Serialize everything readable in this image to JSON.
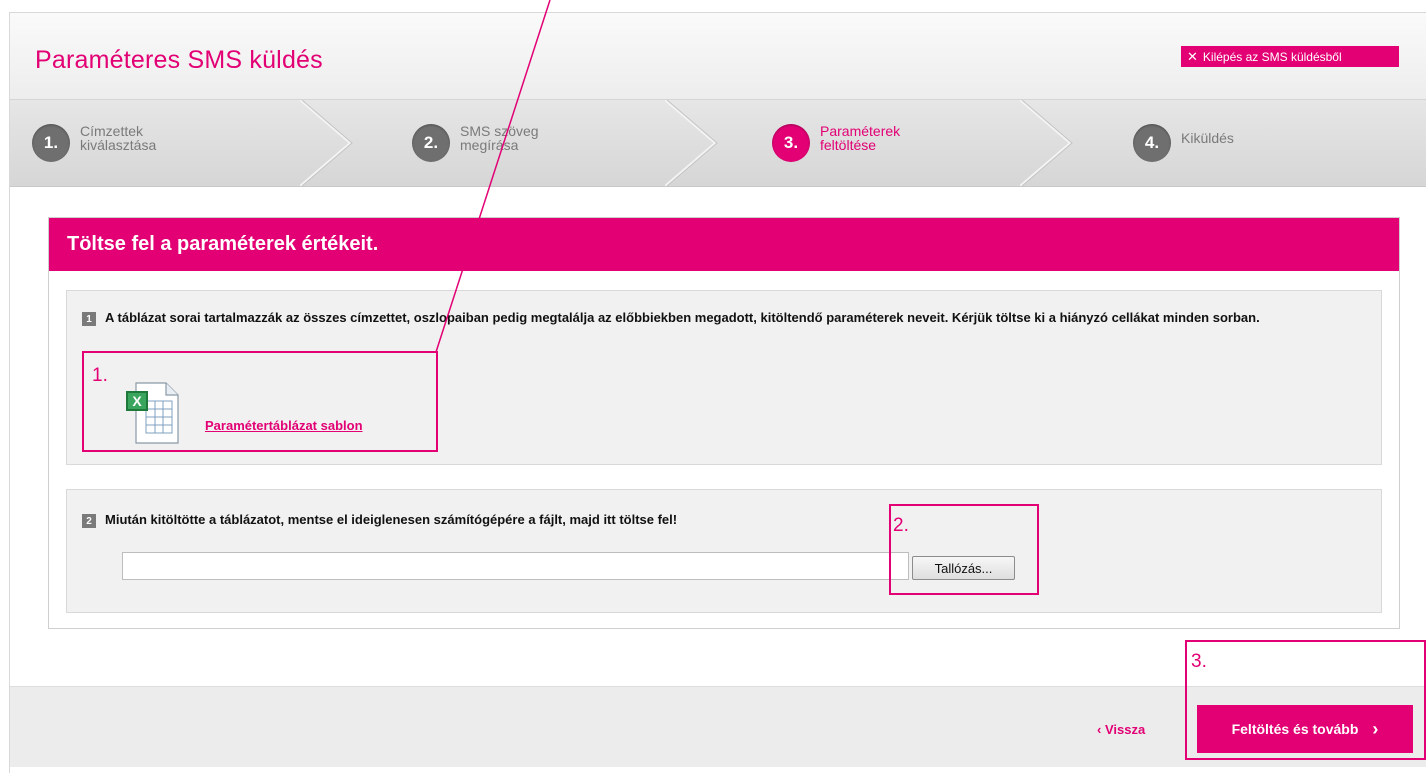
{
  "header": {
    "title": "Paraméteres SMS küldés",
    "exit_label": "Kilépés az SMS küldésből",
    "exit_icon": "close-icon"
  },
  "steps": [
    {
      "number": "1.",
      "label": "Címzettek\nkiválasztása",
      "active": false
    },
    {
      "number": "2.",
      "label": "SMS szöveg\nmegírása",
      "active": false
    },
    {
      "number": "3.",
      "label": "Paraméterek\nfeltöltése",
      "active": true
    },
    {
      "number": "4.",
      "label": "Kiküldés",
      "active": false
    }
  ],
  "panel": {
    "heading": "Töltse fel a paraméterek értékeit.",
    "section1": {
      "badge": "1",
      "text": "A táblázat sorai tartalmazzák az összes címzettet, oszlopaiban pedig megtalálja az előbbiekben megadott, kitöltendő paraméterek neveit. Kérjük töltse ki a hiányzó cellákat minden sorban.",
      "link_label": "Paramétertáblázat sablon",
      "icon": "excel-file-icon"
    },
    "section2": {
      "badge": "2",
      "text": "Miután kitöltötte a táblázatot, mentse el ideiglenesen számítógépére a fájlt, majd itt töltse fel!",
      "file_value": "",
      "browse_label": "Tallózás..."
    }
  },
  "footer": {
    "back_label": "Vissza",
    "next_label": "Feltöltés és tovább"
  },
  "annotations": {
    "a1": "1.",
    "a2": "2.",
    "a3": "3."
  },
  "colors": {
    "accent": "#e20074",
    "step_inactive": "#6f6f6f"
  }
}
